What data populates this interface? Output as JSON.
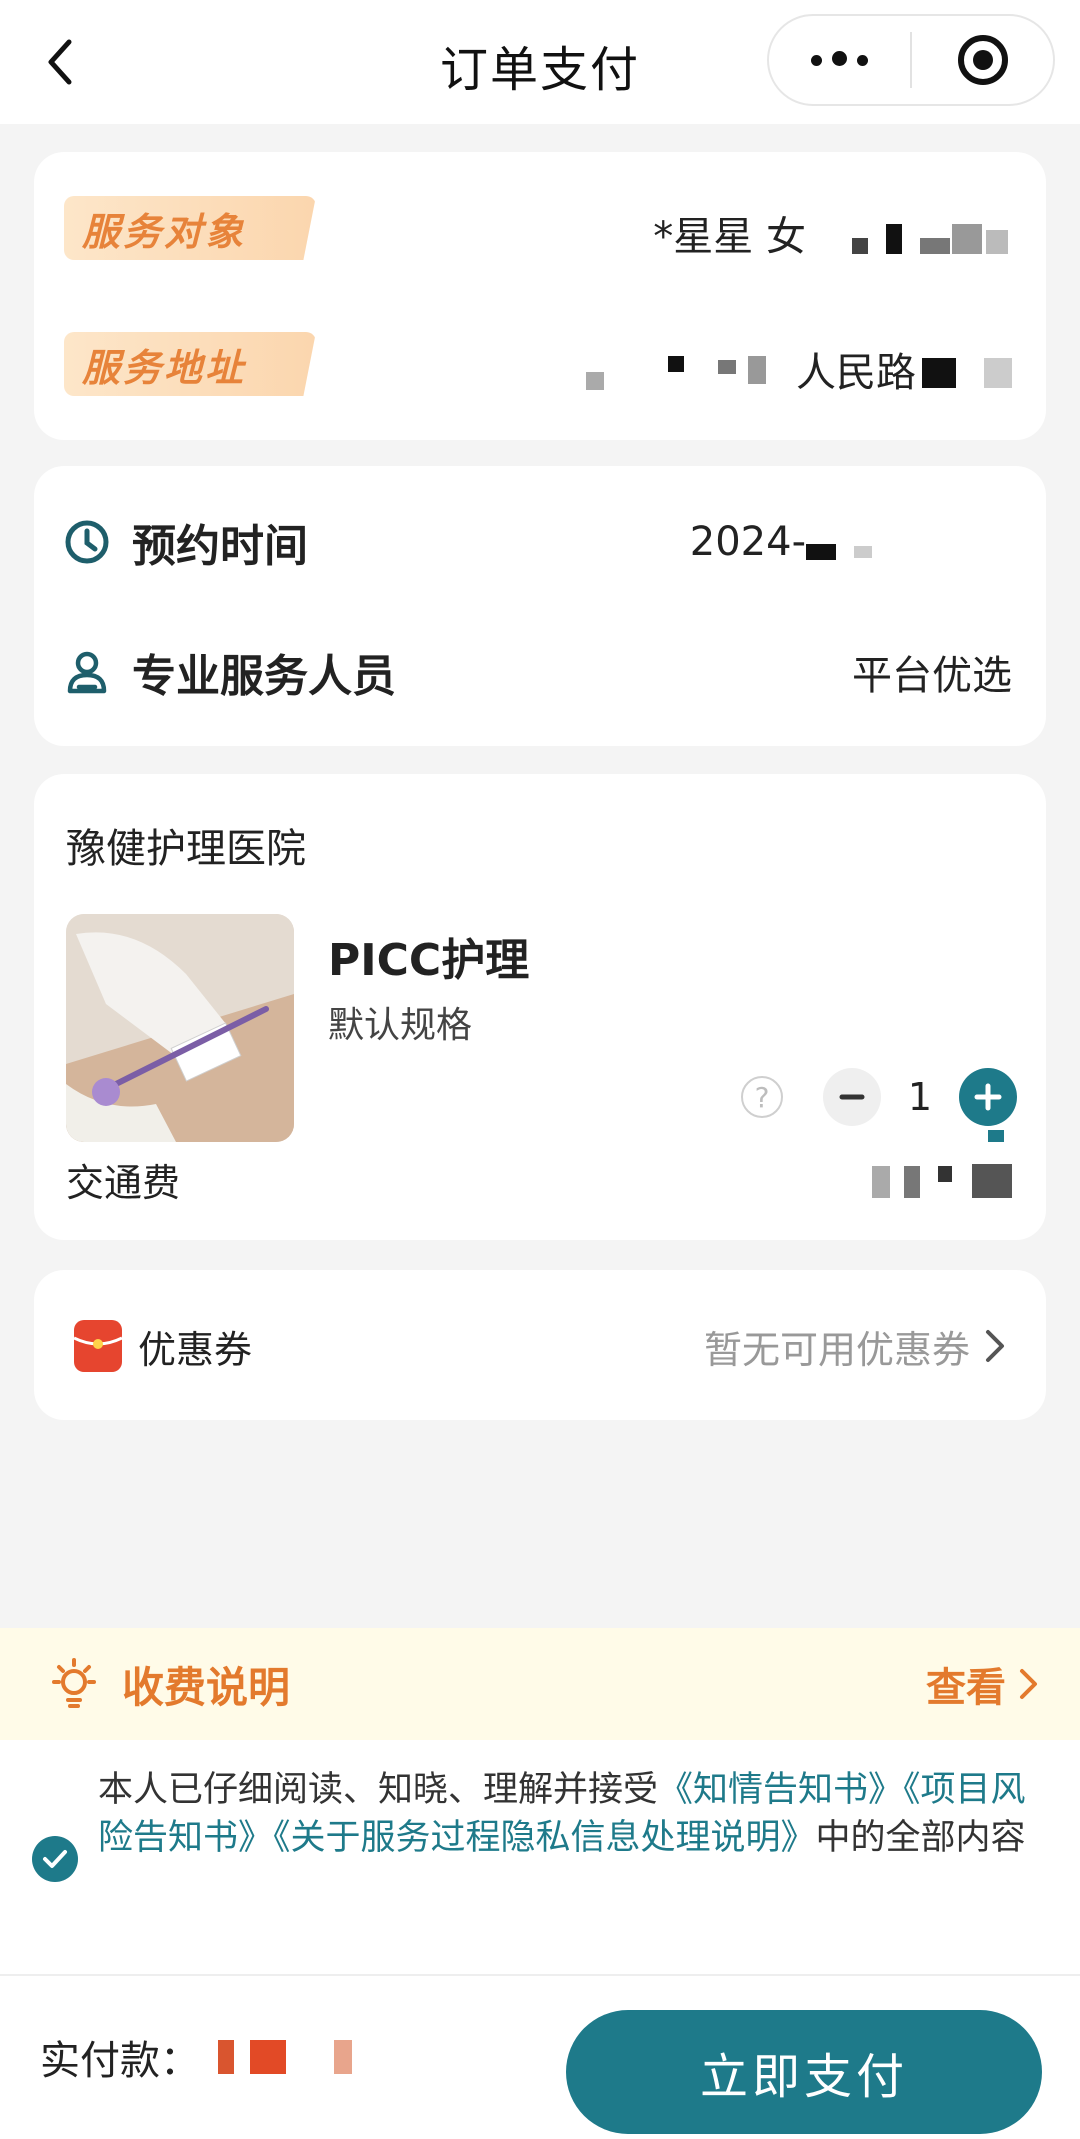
{
  "navbar": {
    "title": "订单支付"
  },
  "service": {
    "target_tag": "服务对象",
    "target_value": "*星星 女",
    "address_tag": "服务地址",
    "address_value": "人民路"
  },
  "appointment": {
    "time_label": "预约时间",
    "time_value": "2024-",
    "staff_label": "专业服务人员",
    "staff_value": "平台优选"
  },
  "order": {
    "hospital": "豫健护理医院",
    "product_name": "PICC护理",
    "product_spec": "默认规格",
    "help_mark": "?",
    "quantity": "1",
    "fee_label": "交通费"
  },
  "coupon": {
    "label": "优惠券",
    "status": "暂无可用优惠券"
  },
  "fee_note": {
    "title": "收费说明",
    "view": "查看"
  },
  "agreement": {
    "prefix": "本人已仔细阅读、知晓、理解并接受",
    "link1": "《知情告知书》",
    "link2": "《项目风险告知书》",
    "link3": "《关于服务过程隐私信息处理说明》",
    "suffix": "中的全部内容"
  },
  "bottom": {
    "pay_label": "实付款：",
    "pay_button": "立即支付"
  },
  "colors": {
    "primary": "#1e7a8a",
    "accent_orange": "#e37a2d",
    "tag_bg": "#fbd6ae",
    "coupon_red": "#e6452f"
  },
  "icons": [
    "back-arrow-icon",
    "more-dots-icon",
    "target-icon",
    "clock-icon",
    "person-icon",
    "help-icon",
    "minus-icon",
    "plus-icon",
    "coupon-icon",
    "chevron-right-icon",
    "lightbulb-icon",
    "check-icon"
  ]
}
